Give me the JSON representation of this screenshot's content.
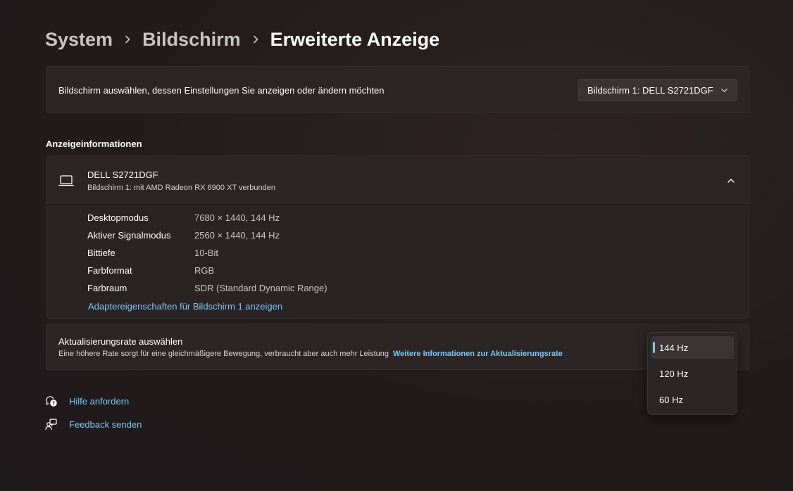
{
  "breadcrumb": {
    "items": [
      "System",
      "Bildschirm",
      "Erweiterte Anzeige"
    ]
  },
  "select_display": {
    "label": "Bildschirm auswählen, dessen Einstellungen Sie anzeigen oder ändern möchten",
    "selected": "Bildschirm 1: DELL S2721DGF"
  },
  "display_info": {
    "section_title": "Anzeigeinformationen",
    "name": "DELL S2721DGF",
    "subtitle": "Bildschirm 1: mit AMD Radeon RX 6900 XT verbunden",
    "rows": [
      {
        "key": "Desktopmodus",
        "value": "7680 × 1440, 144 Hz"
      },
      {
        "key": "Aktiver Signalmodus",
        "value": "2560 × 1440, 144 Hz"
      },
      {
        "key": "Bittiefe",
        "value": "10-Bit"
      },
      {
        "key": "Farbformat",
        "value": "RGB"
      },
      {
        "key": "Farbraum",
        "value": "SDR (Standard Dynamic Range)"
      }
    ],
    "adapter_link": "Adaptereigenschaften für Bildschirm 1 anzeigen"
  },
  "refresh_rate": {
    "title": "Aktualisierungsrate auswählen",
    "description": "Eine höhere Rate sorgt für eine gleichmäßigere Bewegung, verbraucht aber auch mehr Leistung",
    "info_link": "Weitere Informationen zur Aktualisierungsrate",
    "options": [
      "144 Hz",
      "120 Hz",
      "60 Hz"
    ],
    "selected": "144 Hz"
  },
  "footer": {
    "help": "Hilfe anfordern",
    "feedback": "Feedback senden"
  },
  "icons": {
    "chevron_right": "chevron-right-icon",
    "chevron_down": "chevron-down-icon",
    "chevron_up": "chevron-up-icon",
    "laptop": "laptop-icon",
    "help": "help-icon",
    "feedback": "feedback-icon"
  },
  "colors": {
    "accent": "#7cc7f0",
    "card": "#2c2526",
    "background": "#221b1c"
  }
}
